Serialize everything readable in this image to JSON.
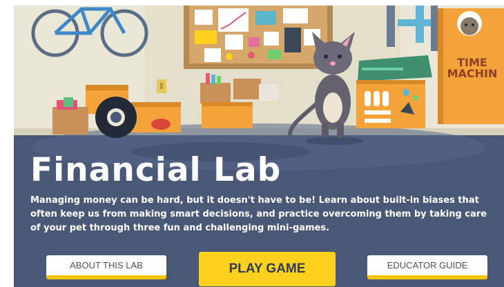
{
  "hero": {
    "title": "Financial Lab",
    "description": "Managing money can be hard, but it doesn't have to be! Learn about built-in biases that often keep us from making smart decisions, and practice overcoming them by taking care of your pet through three fun and challenging mini-games."
  },
  "buttons": {
    "about_label": "ABOUT THIS LAB",
    "play_label": "PLAY GAME",
    "guide_label": "EDUCATOR GUIDE"
  },
  "illustration": {
    "time_machine_text_1": "TIME",
    "time_machine_text_2": "MACHIN"
  },
  "colors": {
    "wall": "#eae7d6",
    "floor": "#4a5878",
    "accent_orange": "#f3a33a",
    "button_yellow": "#ffd11f",
    "button_text_dark": "#2d3b55"
  }
}
